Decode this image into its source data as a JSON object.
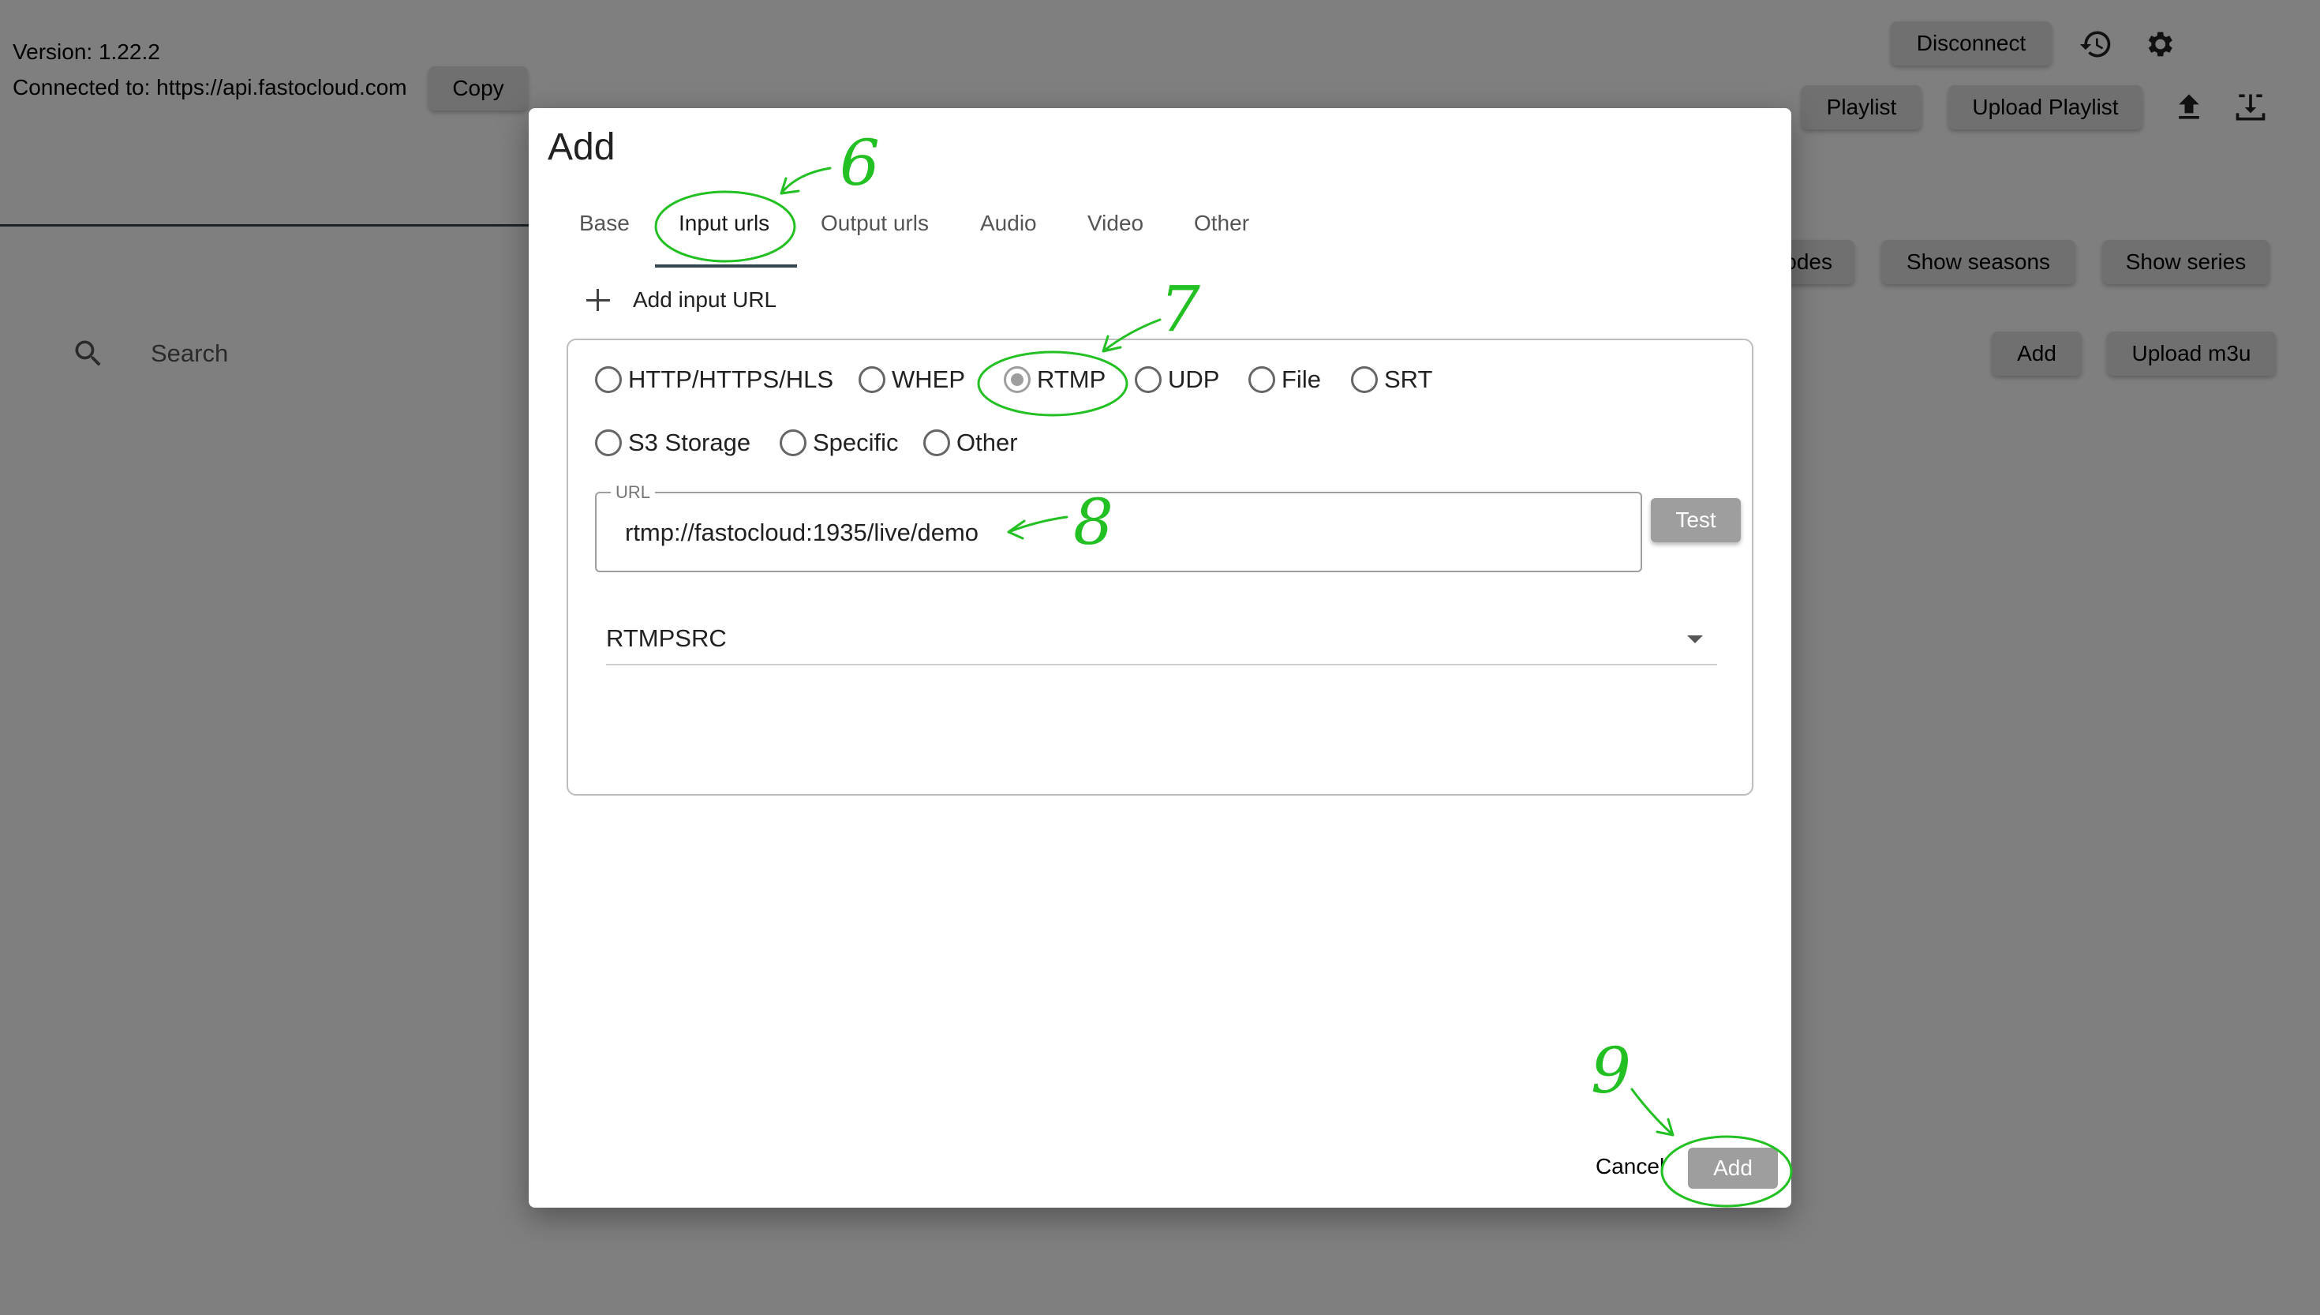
{
  "background": {
    "version_text": "Version: 1.22.2",
    "connected_text": "Connected to: https://api.fastocloud.com",
    "copy_label": "Copy",
    "disconnect_label": "Disconnect",
    "playlist_label": "Playlist",
    "upload_playlist_label": "Upload Playlist",
    "episodes_partial_label": "odes",
    "show_seasons_label": "Show seasons",
    "show_series_label": "Show series",
    "search_placeholder": "Search",
    "add_label": "Add",
    "upload_m3u_label": "Upload m3u"
  },
  "dialog": {
    "title": "Add",
    "tabs": [
      {
        "label": "Base"
      },
      {
        "label": "Input urls",
        "active": true
      },
      {
        "label": "Output urls"
      },
      {
        "label": "Audio"
      },
      {
        "label": "Video"
      },
      {
        "label": "Other"
      }
    ],
    "add_input_url_label": "Add input URL",
    "input_types": [
      {
        "label": "HTTP/HTTPS/HLS",
        "selected": false
      },
      {
        "label": "WHEP",
        "selected": false
      },
      {
        "label": "RTMP",
        "selected": true
      },
      {
        "label": "UDP",
        "selected": false
      },
      {
        "label": "File",
        "selected": false
      },
      {
        "label": "SRT",
        "selected": false
      },
      {
        "label": "S3 Storage",
        "selected": false
      },
      {
        "label": "Specific",
        "selected": false
      },
      {
        "label": "Other",
        "selected": false
      }
    ],
    "url_field": {
      "label": "URL",
      "value": "rtmp://fastocloud:1935/live/demo"
    },
    "test_label": "Test",
    "source_select": {
      "value": "RTMPSRC"
    },
    "cancel_label": "Cancel",
    "add_label": "Add"
  },
  "annotations": {
    "step_6": "6",
    "step_7": "7",
    "step_8": "8",
    "step_9": "9",
    "color": "#22c022"
  }
}
